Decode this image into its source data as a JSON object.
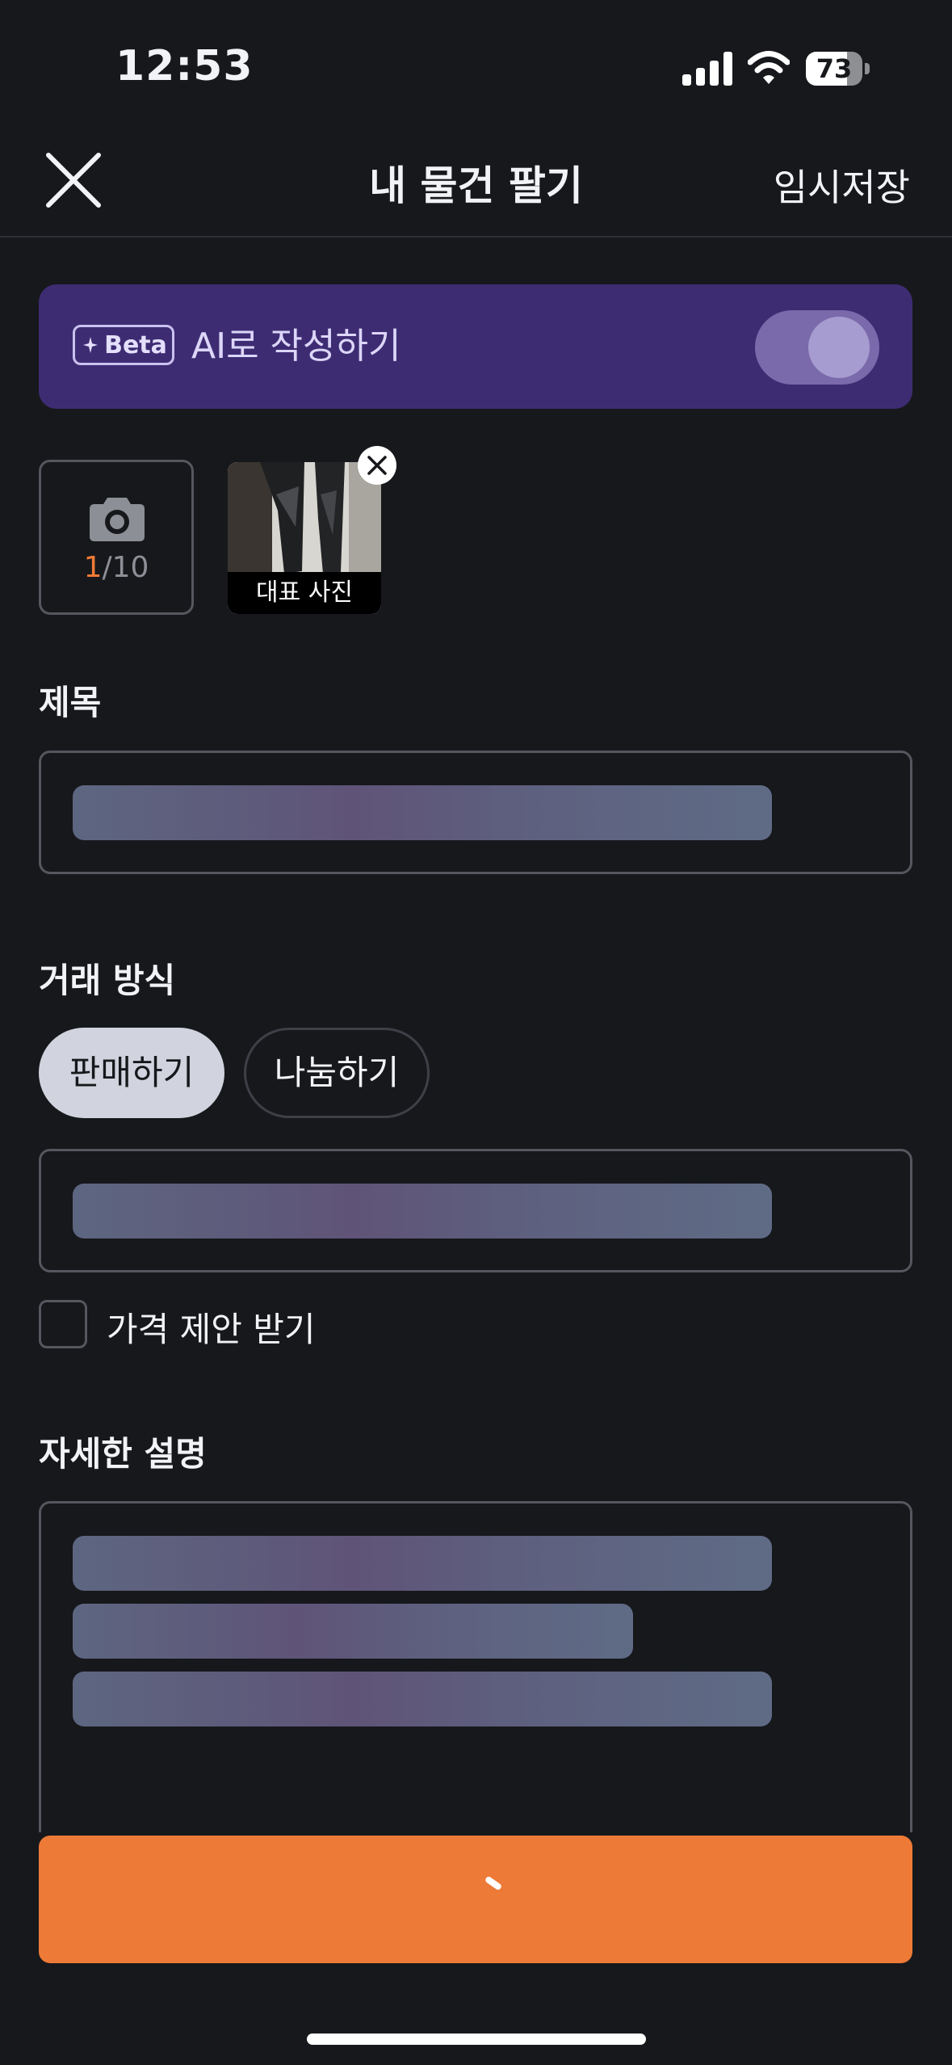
{
  "status_bar": {
    "time": "12:53",
    "battery": "73",
    "battery_level": 0.73
  },
  "nav": {
    "title": "내 물건 팔기",
    "save_label": "임시저장"
  },
  "ai_banner": {
    "badge": "Beta",
    "label": "AI로 작성하기",
    "enabled": true
  },
  "photos": {
    "current": "1",
    "max": "/10",
    "caption": "대표 사진"
  },
  "title_section": {
    "label": "제목"
  },
  "trade_section": {
    "label": "거래 방식",
    "options": [
      {
        "label": "판매하기",
        "selected": true
      },
      {
        "label": "나눔하기",
        "selected": false
      }
    ]
  },
  "price_offer": {
    "label": "가격 제안 받기",
    "checked": false
  },
  "description_section": {
    "label": "자세한 설명"
  },
  "colors": {
    "accent": "#ee7a37",
    "ai_banner": "#3e2c73",
    "background": "#17181c"
  },
  "icons": [
    "close-icon",
    "camera-icon",
    "sparkle-icon",
    "remove-photo-icon",
    "wifi-icon",
    "signal-icon",
    "battery-icon"
  ]
}
